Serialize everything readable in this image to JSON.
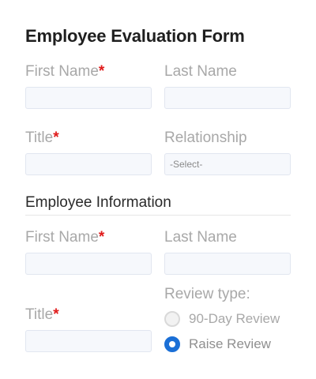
{
  "form": {
    "title": "Employee Evaluation Form",
    "required_marker": "*",
    "evaluator": {
      "first_name": {
        "label": "First Name",
        "required": true,
        "value": ""
      },
      "last_name": {
        "label": "Last Name",
        "required": false,
        "value": ""
      },
      "title": {
        "label": "Title",
        "required": true,
        "value": ""
      },
      "relationship": {
        "label": "Relationship",
        "selected": "-Select-"
      }
    },
    "employee_section": {
      "heading": "Employee Information",
      "first_name": {
        "label": "First Name",
        "required": true,
        "value": ""
      },
      "last_name": {
        "label": "Last Name",
        "required": false,
        "value": ""
      },
      "title": {
        "label": "Title",
        "required": true,
        "value": ""
      },
      "review_type": {
        "label": "Review type:",
        "options": [
          {
            "label": "90-Day Review",
            "checked": false
          },
          {
            "label": "Raise Review",
            "checked": true
          }
        ]
      }
    }
  },
  "colors": {
    "required": "#e01b1b",
    "accent": "#1a6fd6",
    "label": "#a8a8a8",
    "input_background": "#f6f8fc",
    "input_border": "#e1e6f0"
  }
}
